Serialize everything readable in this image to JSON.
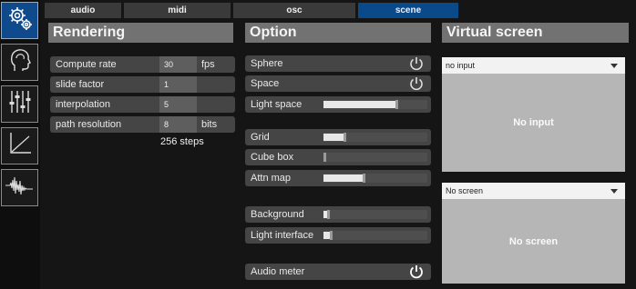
{
  "tabs": [
    {
      "label": "audio"
    },
    {
      "label": "midi"
    },
    {
      "label": "osc"
    },
    {
      "label": "scene"
    }
  ],
  "sidebar": {
    "items": [
      {
        "icon": "gears-icon"
      },
      {
        "icon": "head-icon"
      },
      {
        "icon": "mixer-sliders-icon"
      },
      {
        "icon": "axes-graph-icon"
      },
      {
        "icon": "waveform-icon"
      }
    ]
  },
  "rendering": {
    "title": "Rendering",
    "compute_rate": {
      "label": "Compute rate",
      "value": "30",
      "unit": "fps"
    },
    "slide_factor": {
      "label": "slide factor",
      "value": "1"
    },
    "interpolation": {
      "label": "interpolation",
      "value": "5"
    },
    "path_resolution": {
      "label": "path resolution",
      "value": "8",
      "unit": "bits"
    },
    "steps_text": "256 steps"
  },
  "option": {
    "title": "Option",
    "sphere": {
      "label": "Sphere"
    },
    "space": {
      "label": "Space"
    },
    "light_space": {
      "label": "Light space",
      "level": 0.72
    },
    "grid": {
      "label": "Grid",
      "level": 0.22
    },
    "cube_box": {
      "label": "Cube box",
      "level": 0.03
    },
    "attn_map": {
      "label": "Attn map",
      "level": 0.4
    },
    "background": {
      "label": "Background",
      "level": 0.06
    },
    "light_interface": {
      "label": "Light interface",
      "level": 0.09
    },
    "audio_meter": {
      "label": "Audio meter"
    }
  },
  "virtual_screen": {
    "title": "Virtual screen",
    "input_select": "no input",
    "input_display": "No input",
    "screen_select": "No screen",
    "screen_display": "No screen"
  },
  "colors": {
    "accent": "#0b4a8a",
    "panel_title": "#727272",
    "row": "#454545",
    "background": "#151515"
  }
}
